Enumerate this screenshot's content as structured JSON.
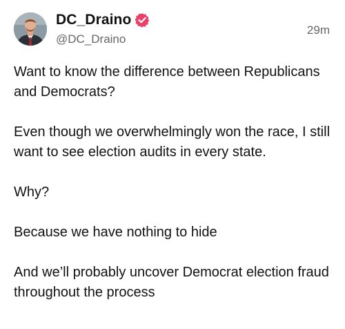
{
  "post": {
    "author": {
      "display_name": "DC_Draino",
      "handle": "@DC_Draino",
      "verified_icon": "verified-badge-icon",
      "avatar_icon": "profile-photo"
    },
    "timestamp": "29m",
    "paragraphs": [
      "Want to know the difference between Republicans and Democrats?",
      "Even though we overwhelmingly won the race, I still want to see election audits in every state.",
      "Why?",
      "Because we have nothing to hide",
      "And we’ll probably uncover Democrat election fraud throughout the process"
    ]
  },
  "colors": {
    "text": "#111111",
    "secondary_text": "#666666",
    "verified_badge": "#e8426a",
    "background": "#ffffff"
  }
}
